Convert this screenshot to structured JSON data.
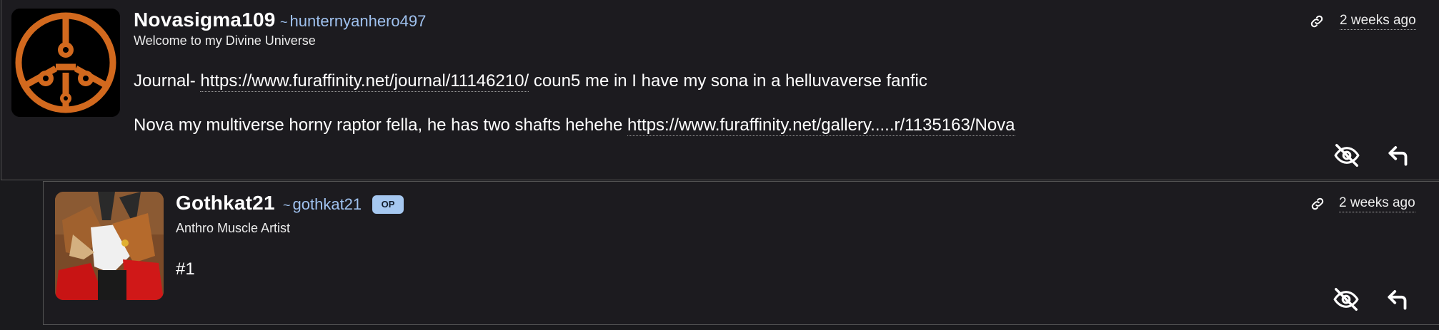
{
  "comments": [
    {
      "display_name": "Novasigma109",
      "handle_prefix": "~",
      "username": "hunternyanhero497",
      "subtitle": "Welcome to my Divine Universe",
      "time": "2 weeks ago",
      "avatar_icon": "orange-hub-symbol-icon",
      "body": [
        {
          "prefix": "Journal- ",
          "link": "https://www.furaffinity.net/journal/11146210/",
          "suffix": " coun5 me in I have my sona in a helluvaverse fanfic"
        },
        {
          "prefix": "Nova my multiverse horny raptor fella, he has two shafts hehehe ",
          "link": "https://www.furaffinity.net/gallery.....r/1135163/Nova",
          "suffix": ""
        }
      ]
    },
    {
      "display_name": "Gothkat21",
      "handle_prefix": "~",
      "username": "gothkat21",
      "badge": "OP",
      "subtitle": "Anthro Muscle Artist",
      "time": "2 weeks ago",
      "body_text": "#1"
    }
  ],
  "colors": {
    "background": "#1c1b1f",
    "border": "#545454",
    "handle": "#9fc1ee",
    "op_badge": "#a6c8f0",
    "avatar_orange": "#d2691e"
  },
  "icons": [
    "link-icon",
    "hide-eye-slash-icon",
    "reply-arrow-icon"
  ]
}
